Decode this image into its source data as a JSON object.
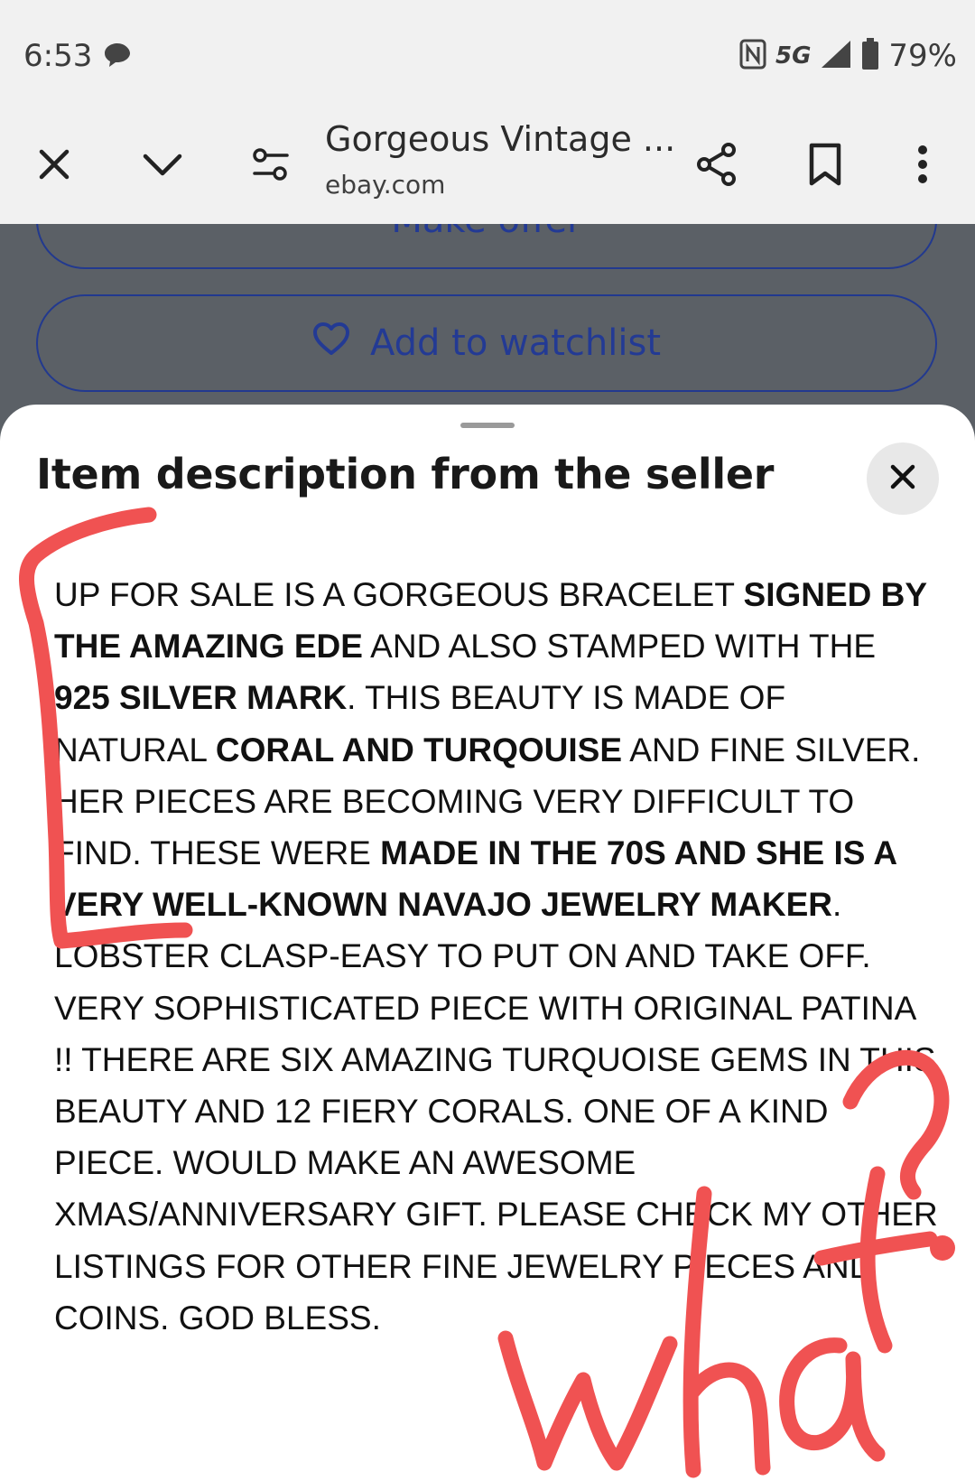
{
  "status": {
    "time": "6:53",
    "network": "5G",
    "battery": "79%"
  },
  "toolbar": {
    "title": "Gorgeous Vintage ...",
    "url": "ebay.com"
  },
  "background_buttons": {
    "make_offer": "Make offer",
    "watchlist": "Add to watchlist"
  },
  "sheet": {
    "title": "Item description from the seller",
    "description": [
      {
        "text": "UP FOR SALE IS A GORGEOUS BRACELET ",
        "bold": false
      },
      {
        "text": "SIGNED BY THE AMAZING EDE",
        "bold": true
      },
      {
        "text": " AND ALSO STAMPED WITH THE ",
        "bold": false
      },
      {
        "text": "925 SILVER MARK",
        "bold": true
      },
      {
        "text": ". THIS BEAUTY IS MADE OF NATURAL ",
        "bold": false
      },
      {
        "text": "CORAL AND TURQOUISE",
        "bold": true
      },
      {
        "text": " AND FINE SILVER. HER PIECES ARE BECOMING VERY DIFFICULT TO FIND. THESE WERE ",
        "bold": false
      },
      {
        "text": "MADE IN THE 70S AND SHE IS A VERY WELL-KNOWN NAVAJO JEWELRY MAKER",
        "bold": true
      },
      {
        "text": ". LOBSTER CLASP-EASY TO PUT ON AND TAKE OFF. VERY SOPHISTICATED PIECE WITH ORIGINAL PATINA !! THERE ARE SIX AMAZING TURQUOISE GEMS IN THIS BEAUTY AND 12 FIERY CORALS. ONE OF A KIND PIECE. WOULD MAKE AN AWESOME XMAS/ANNIVERSARY GIFT. PLEASE CHECK MY OTHER LISTINGS FOR OTHER FINE JEWELRY PIECES AND COINS. GOD BLESS.",
        "bold": false
      }
    ]
  },
  "annotation": {
    "text": "what?",
    "color": "#f05252"
  }
}
